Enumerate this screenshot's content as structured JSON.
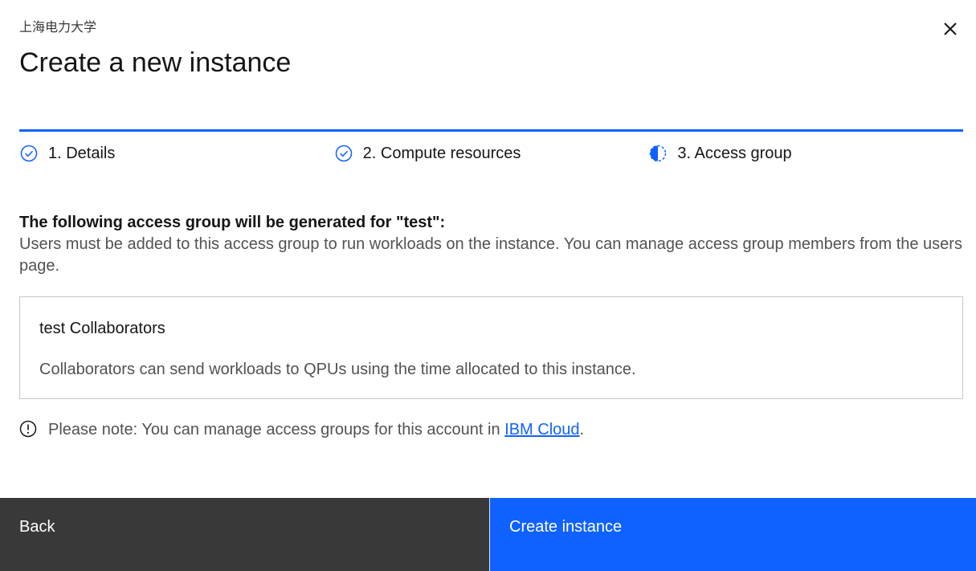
{
  "header": {
    "org_label": "上海电力大学",
    "title": "Create a new instance"
  },
  "progress": {
    "steps": [
      {
        "label": "1. Details",
        "state": "complete",
        "icon": "checkmark-circle-icon"
      },
      {
        "label": "2. Compute resources",
        "state": "complete",
        "icon": "checkmark-circle-icon"
      },
      {
        "label": "3. Access group",
        "state": "current",
        "icon": "half-circle-icon"
      }
    ]
  },
  "access_group": {
    "heading": "The following access group will be generated for \"test\":",
    "description": "Users must be added to this access group to run workloads on the instance. You can manage access group members from the users page.",
    "group_name": "test Collaborators",
    "group_description": "Collaborators can send workloads to QPUs using the time allocated to this instance."
  },
  "note": {
    "text_before": "Please note: You can manage access groups for this account in ",
    "link_text": "IBM Cloud",
    "text_after": "."
  },
  "footer": {
    "back_label": "Back",
    "create_label": "Create instance"
  },
  "colors": {
    "accent": "#0f62fe",
    "back_button": "#393939",
    "border": "#c6c6c6"
  }
}
